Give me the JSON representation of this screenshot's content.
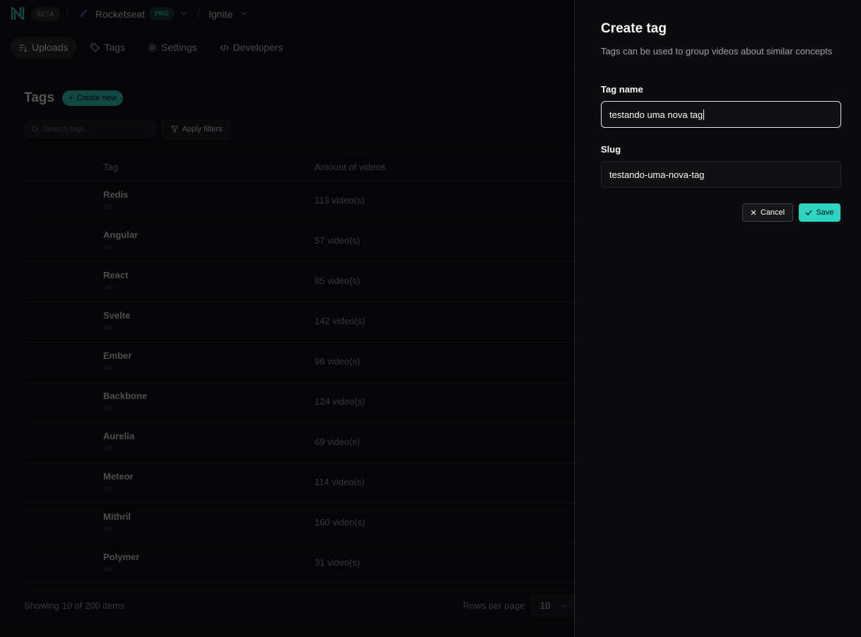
{
  "header": {
    "beta_badge": "BETA",
    "org_name": "Rocketseat",
    "pro_badge": "PRO",
    "project_name": "Ignite"
  },
  "nav": {
    "items": [
      {
        "label": "Uploads",
        "icon": "uploads-icon"
      },
      {
        "label": "Tags",
        "icon": "tag-icon"
      },
      {
        "label": "Settings",
        "icon": "gear-icon"
      },
      {
        "label": "Developers",
        "icon": "code-icon"
      }
    ]
  },
  "page": {
    "title": "Tags",
    "create_label": "Create new",
    "search_placeholder": "Search tags...",
    "apply_filters_label": "Apply filters"
  },
  "table": {
    "columns": [
      "Tag",
      "Amount of videos"
    ],
    "rows": [
      {
        "name": "Redis",
        "slug": "old",
        "count": "113 video(s)"
      },
      {
        "name": "Angular",
        "slug": "old",
        "count": "57 video(s)"
      },
      {
        "name": "React",
        "slug": "old",
        "count": "85 video(s)"
      },
      {
        "name": "Svelte",
        "slug": "old",
        "count": "142 video(s)"
      },
      {
        "name": "Ember",
        "slug": "old",
        "count": "96 video(s)"
      },
      {
        "name": "Backbone",
        "slug": "old",
        "count": "124 video(s)"
      },
      {
        "name": "Aurelia",
        "slug": "old",
        "count": "69 video(s)"
      },
      {
        "name": "Meteor",
        "slug": "old",
        "count": "114 video(s)"
      },
      {
        "name": "Mithril",
        "slug": "old",
        "count": "160 video(s)"
      },
      {
        "name": "Polymer",
        "slug": "old",
        "count": "31 video(s)"
      }
    ]
  },
  "footer": {
    "showing_text": "Showing 10 of 200 items",
    "rows_per_page_label": "Rows per page",
    "rows_per_page_value": "10"
  },
  "sheet": {
    "title": "Create tag",
    "description": "Tags can be used to group videos about similar concepts",
    "tag_name_label": "Tag name",
    "tag_name_value": "testando uma nova tag",
    "slug_label": "Slug",
    "slug_value": "testando-uma-nova-tag",
    "cancel_label": "Cancel",
    "save_label": "Save"
  },
  "colors": {
    "accent": "#2dd4bf",
    "background": "#09090b",
    "border": "#27272a"
  }
}
